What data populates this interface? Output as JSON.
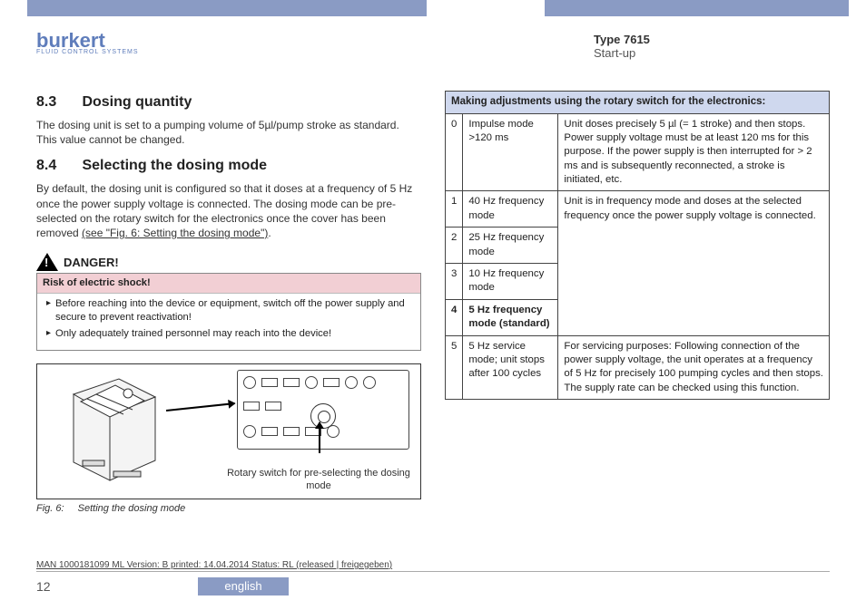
{
  "header": {
    "logo_main": "burkert",
    "logo_sub": "FLUID CONTROL SYSTEMS",
    "type_line": "Type 7615",
    "startup": "Start-up"
  },
  "sections": {
    "s83_num": "8.3",
    "s83_title": "Dosing quantity",
    "s83_body": "The dosing unit is set to a pumping volume of 5µl/pump stroke as standard. This value cannot be changed.",
    "s84_num": "8.4",
    "s84_title": "Selecting the dosing mode",
    "s84_body_a": "By default, the dosing unit is configured so that it doses at a frequency of 5 Hz once the power supply voltage is connected. The dosing mode can be pre-selected on the rotary switch for the electronics once the cover has been removed ",
    "s84_figref": "(see \"Fig. 6: Setting the dosing mode\")",
    "s84_body_b": "."
  },
  "danger": {
    "label": "DANGER!",
    "title": "Risk of electric shock!",
    "items": [
      "Before reaching into the device or equipment, switch off the power supply and secure to prevent reactivation!",
      "Only adequately trained personnel may reach into the device!"
    ]
  },
  "figure": {
    "sublabel": "Rotary switch for pre-selecting the dosing mode",
    "num": "Fig. 6:",
    "caption": "Setting the dosing mode"
  },
  "table": {
    "header": "Making adjustments using the rotary switch for the electronics:",
    "rows": [
      {
        "pos": "0",
        "mode": "Impulse mode\n>120 ms",
        "desc": "Unit doses precisely 5 µl (= 1 stroke) and then stops. Power supply voltage must be at least 120 ms for this purpose. If the power supply is then interrupted for > 2 ms and is subsequently reconnected, a stroke is initiated, etc."
      },
      {
        "pos": "1",
        "mode": "40 Hz frequency mode",
        "desc": "Unit is in frequency mode and doses at the selected frequency once the power supply voltage is connected."
      },
      {
        "pos": "2",
        "mode": "25 Hz frequency mode",
        "desc": ""
      },
      {
        "pos": "3",
        "mode": "10 Hz frequency mode",
        "desc": ""
      },
      {
        "pos": "4",
        "mode": "5 Hz frequency mode (standard)",
        "desc": ""
      },
      {
        "pos": "5",
        "mode": "5 Hz service mode; unit stops after 100 cycles",
        "desc": "For servicing purposes: Following connection of the power supply voltage, the unit operates at a frequency of 5 Hz for precisely 100 pumping cycles and then stops.\nThe supply rate can be checked using this function."
      }
    ]
  },
  "footer": {
    "meta": "MAN 1000181099 ML Version: B printed: 14.04.2014 Status: RL (released | freigegeben)",
    "page": "12",
    "lang": "english"
  }
}
